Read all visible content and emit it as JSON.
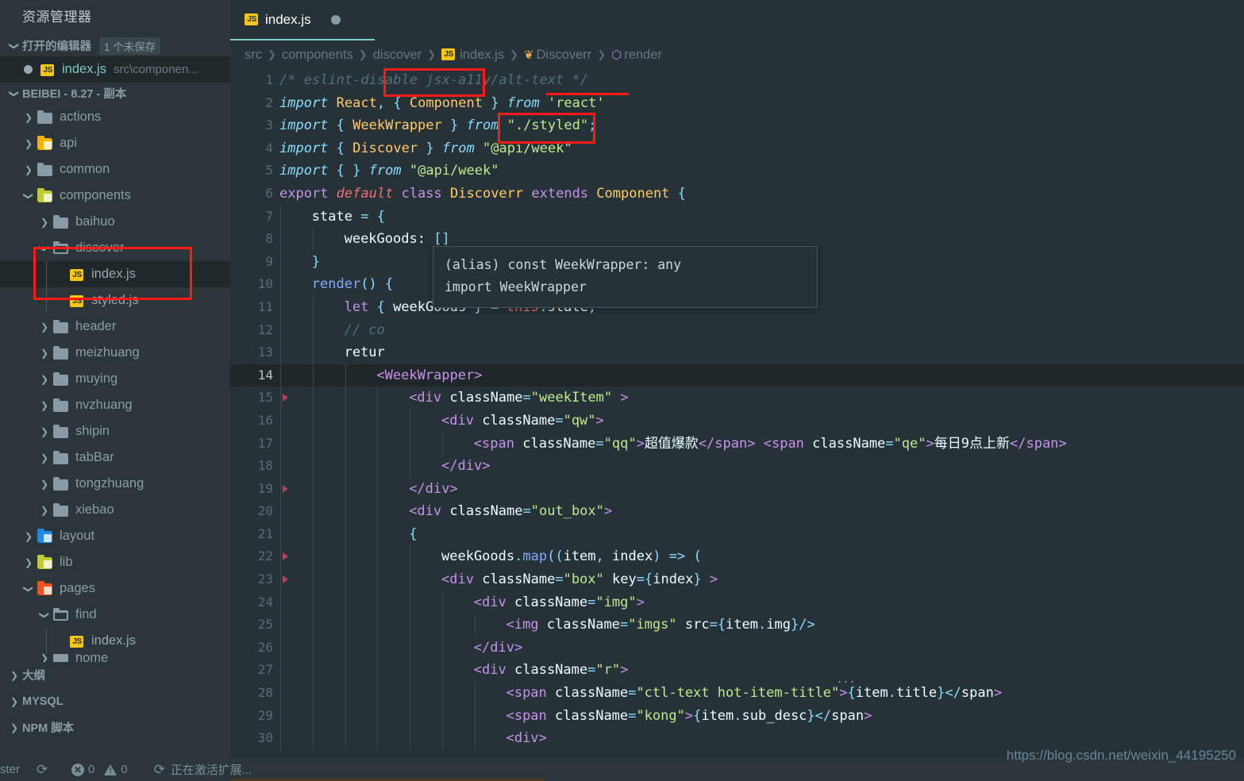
{
  "sidebar": {
    "title": "资源管理器",
    "opened_editors": {
      "label": "打开的编辑器",
      "badge": "1 个未保存",
      "items": [
        {
          "name": "index.js",
          "sub": "src\\componen...",
          "icon": "js-file-icon",
          "unsaved": true
        }
      ]
    },
    "project": {
      "label": "BEIBEI - 8.27 - 副本",
      "tree": [
        {
          "label": "actions",
          "depth": 1,
          "kind": "folder",
          "icon": "folder-icon",
          "expanded": false
        },
        {
          "label": "api",
          "depth": 1,
          "kind": "folder",
          "icon": "folder-api-icon",
          "expanded": false
        },
        {
          "label": "common",
          "depth": 1,
          "kind": "folder",
          "icon": "folder-icon",
          "expanded": false
        },
        {
          "label": "components",
          "depth": 1,
          "kind": "folder",
          "icon": "folder-components-icon",
          "expanded": true
        },
        {
          "label": "baihuo",
          "depth": 2,
          "kind": "folder",
          "icon": "folder-icon",
          "expanded": false
        },
        {
          "label": "discover",
          "depth": 2,
          "kind": "folder-open",
          "icon": "folder-open-icon",
          "expanded": true,
          "highlighted": true
        },
        {
          "label": "index.js",
          "depth": 3,
          "kind": "file",
          "icon": "js-file-icon",
          "selected": true,
          "highlighted": true
        },
        {
          "label": "styled.js",
          "depth": 3,
          "kind": "file",
          "icon": "js-file-icon"
        },
        {
          "label": "header",
          "depth": 2,
          "kind": "folder",
          "icon": "folder-icon",
          "expanded": false
        },
        {
          "label": "meizhuang",
          "depth": 2,
          "kind": "folder",
          "icon": "folder-icon",
          "expanded": false
        },
        {
          "label": "muying",
          "depth": 2,
          "kind": "folder",
          "icon": "folder-icon",
          "expanded": false
        },
        {
          "label": "nvzhuang",
          "depth": 2,
          "kind": "folder",
          "icon": "folder-icon",
          "expanded": false
        },
        {
          "label": "shipin",
          "depth": 2,
          "kind": "folder",
          "icon": "folder-icon",
          "expanded": false
        },
        {
          "label": "tabBar",
          "depth": 2,
          "kind": "folder",
          "icon": "folder-icon",
          "expanded": false
        },
        {
          "label": "tongzhuang",
          "depth": 2,
          "kind": "folder",
          "icon": "folder-icon",
          "expanded": false
        },
        {
          "label": "xiebao",
          "depth": 2,
          "kind": "folder",
          "icon": "folder-icon",
          "expanded": false
        },
        {
          "label": "layout",
          "depth": 1,
          "kind": "folder",
          "icon": "folder-layout-icon",
          "expanded": false
        },
        {
          "label": "lib",
          "depth": 1,
          "kind": "folder",
          "icon": "folder-lib-icon",
          "expanded": false
        },
        {
          "label": "pages",
          "depth": 1,
          "kind": "folder",
          "icon": "folder-pages-icon",
          "expanded": true
        },
        {
          "label": "find",
          "depth": 2,
          "kind": "folder-open",
          "icon": "folder-open-icon",
          "expanded": true
        },
        {
          "label": "index.js",
          "depth": 3,
          "kind": "file",
          "icon": "js-file-icon"
        },
        {
          "label": "home",
          "depth": 2,
          "kind": "folder",
          "icon": "folder-icon",
          "expanded": false,
          "clipped": true
        }
      ]
    },
    "bottom_sections": [
      {
        "label": "大纲",
        "expanded": false
      },
      {
        "label": "MYSQL",
        "expanded": false
      },
      {
        "label": "NPM 脚本",
        "expanded": false
      }
    ]
  },
  "editor": {
    "tab": {
      "label": "index.js",
      "icon": "js-file-icon",
      "dirty": true
    },
    "breadcrumb": [
      {
        "label": "src",
        "icon": null
      },
      {
        "label": "components",
        "icon": null
      },
      {
        "label": "discover",
        "icon": null
      },
      {
        "label": "index.js",
        "icon": "js-file-icon"
      },
      {
        "label": "Discoverr",
        "icon": "class-symbol-icon"
      },
      {
        "label": "render",
        "icon": "method-symbol-icon"
      }
    ],
    "active_line": 14,
    "first_line": 1,
    "last_line": 30,
    "lines": [
      {
        "n": 1,
        "indent": 0,
        "fold": false,
        "code": "/* eslint-disable jsx-a11y/alt-text */"
      },
      {
        "n": 2,
        "indent": 0,
        "fold": false,
        "code": "import React, { Component } from 'react'"
      },
      {
        "n": 3,
        "indent": 0,
        "fold": false,
        "code": "import { WeekWrapper } from \"./styled\";"
      },
      {
        "n": 4,
        "indent": 0,
        "fold": false,
        "code": "import { Discover } from \"@api/week\""
      },
      {
        "n": 5,
        "indent": 0,
        "fold": false,
        "code": "import { } from \"@api/week\""
      },
      {
        "n": 6,
        "indent": 0,
        "fold": false,
        "code": "export default class Discoverr extends Component {"
      },
      {
        "n": 7,
        "indent": 1,
        "fold": false,
        "code": "state = {"
      },
      {
        "n": 8,
        "indent": 2,
        "fold": false,
        "code": "weekGoods: []"
      },
      {
        "n": 9,
        "indent": 1,
        "fold": false,
        "code": "}"
      },
      {
        "n": 10,
        "indent": 1,
        "fold": false,
        "code": "render() {"
      },
      {
        "n": 11,
        "indent": 2,
        "fold": false,
        "code": "let { weekGoods } = this.state;"
      },
      {
        "n": 12,
        "indent": 2,
        "fold": false,
        "code": "// co"
      },
      {
        "n": 13,
        "indent": 2,
        "fold": false,
        "code": "retur"
      },
      {
        "n": 14,
        "indent": 3,
        "fold": false,
        "code": "<WeekWrapper>"
      },
      {
        "n": 15,
        "indent": 4,
        "fold": true,
        "code": "<div className=\"weekItem\" >"
      },
      {
        "n": 16,
        "indent": 5,
        "fold": false,
        "code": "<div className=\"qw\">"
      },
      {
        "n": 17,
        "indent": 6,
        "fold": false,
        "code": "<span className=\"qq\">超值爆款</span> <span className=\"qe\">每日9点上新</span>"
      },
      {
        "n": 18,
        "indent": 5,
        "fold": false,
        "code": "</div>"
      },
      {
        "n": 19,
        "indent": 4,
        "fold": true,
        "code": "</div>"
      },
      {
        "n": 20,
        "indent": 4,
        "fold": false,
        "code": "<div className=\"out_box\">"
      },
      {
        "n": 21,
        "indent": 4,
        "fold": false,
        "code": "{"
      },
      {
        "n": 22,
        "indent": 5,
        "fold": true,
        "code": "weekGoods.map((item, index) => ("
      },
      {
        "n": 23,
        "indent": 5,
        "fold": true,
        "code": "<div className=\"box\" key={index} >"
      },
      {
        "n": 24,
        "indent": 6,
        "fold": false,
        "code": "<div className=\"img\">"
      },
      {
        "n": 25,
        "indent": 7,
        "fold": false,
        "code": "<img className=\"imgs\" src={item.img}/>"
      },
      {
        "n": 26,
        "indent": 6,
        "fold": false,
        "code": "</div>"
      },
      {
        "n": 27,
        "indent": 6,
        "fold": false,
        "code": "<div className=\"r\">"
      },
      {
        "n": 28,
        "indent": 7,
        "fold": false,
        "code": "<span className=\"ctl-text hot-item-title\">{item.title}</span>"
      },
      {
        "n": 29,
        "indent": 7,
        "fold": false,
        "code": "<span className=\"kong\">{item.sub_desc}</span>"
      },
      {
        "n": 30,
        "indent": 7,
        "fold": false,
        "code": "<div>"
      }
    ],
    "tooltip": {
      "line1": "(alias) const WeekWrapper: any",
      "line2": "import WeekWrapper"
    },
    "annotations": [
      {
        "name": "discover-import-box",
        "target": "Discover"
      },
      {
        "name": "api-week-underline",
        "target": "@api/week"
      },
      {
        "name": "discoverr-class-box",
        "target": "Discoverr"
      },
      {
        "name": "sidebar-discover-folder-box",
        "target": "discover / index.js"
      }
    ],
    "overflow_indicator": "..."
  },
  "statusbar": {
    "branch": "ster",
    "sync_icon": "sync-icon",
    "errors": "0",
    "warnings": "0",
    "activating": "正在激活扩展..."
  },
  "watermark": {
    "url": "https://blog.csdn.net/weixin_44195250"
  },
  "colors": {
    "editor_bg": "#263238",
    "sidebar_bg": "#2b353a",
    "accent": "#80cbc4",
    "annotation_red": "#ff1a1a",
    "string_green": "#c3e88d",
    "tag_red": "#f07178",
    "keyword_purple": "#c792ea",
    "attr_yellow": "#ffcb6b",
    "js_icon_yellow": "#f5c518"
  }
}
